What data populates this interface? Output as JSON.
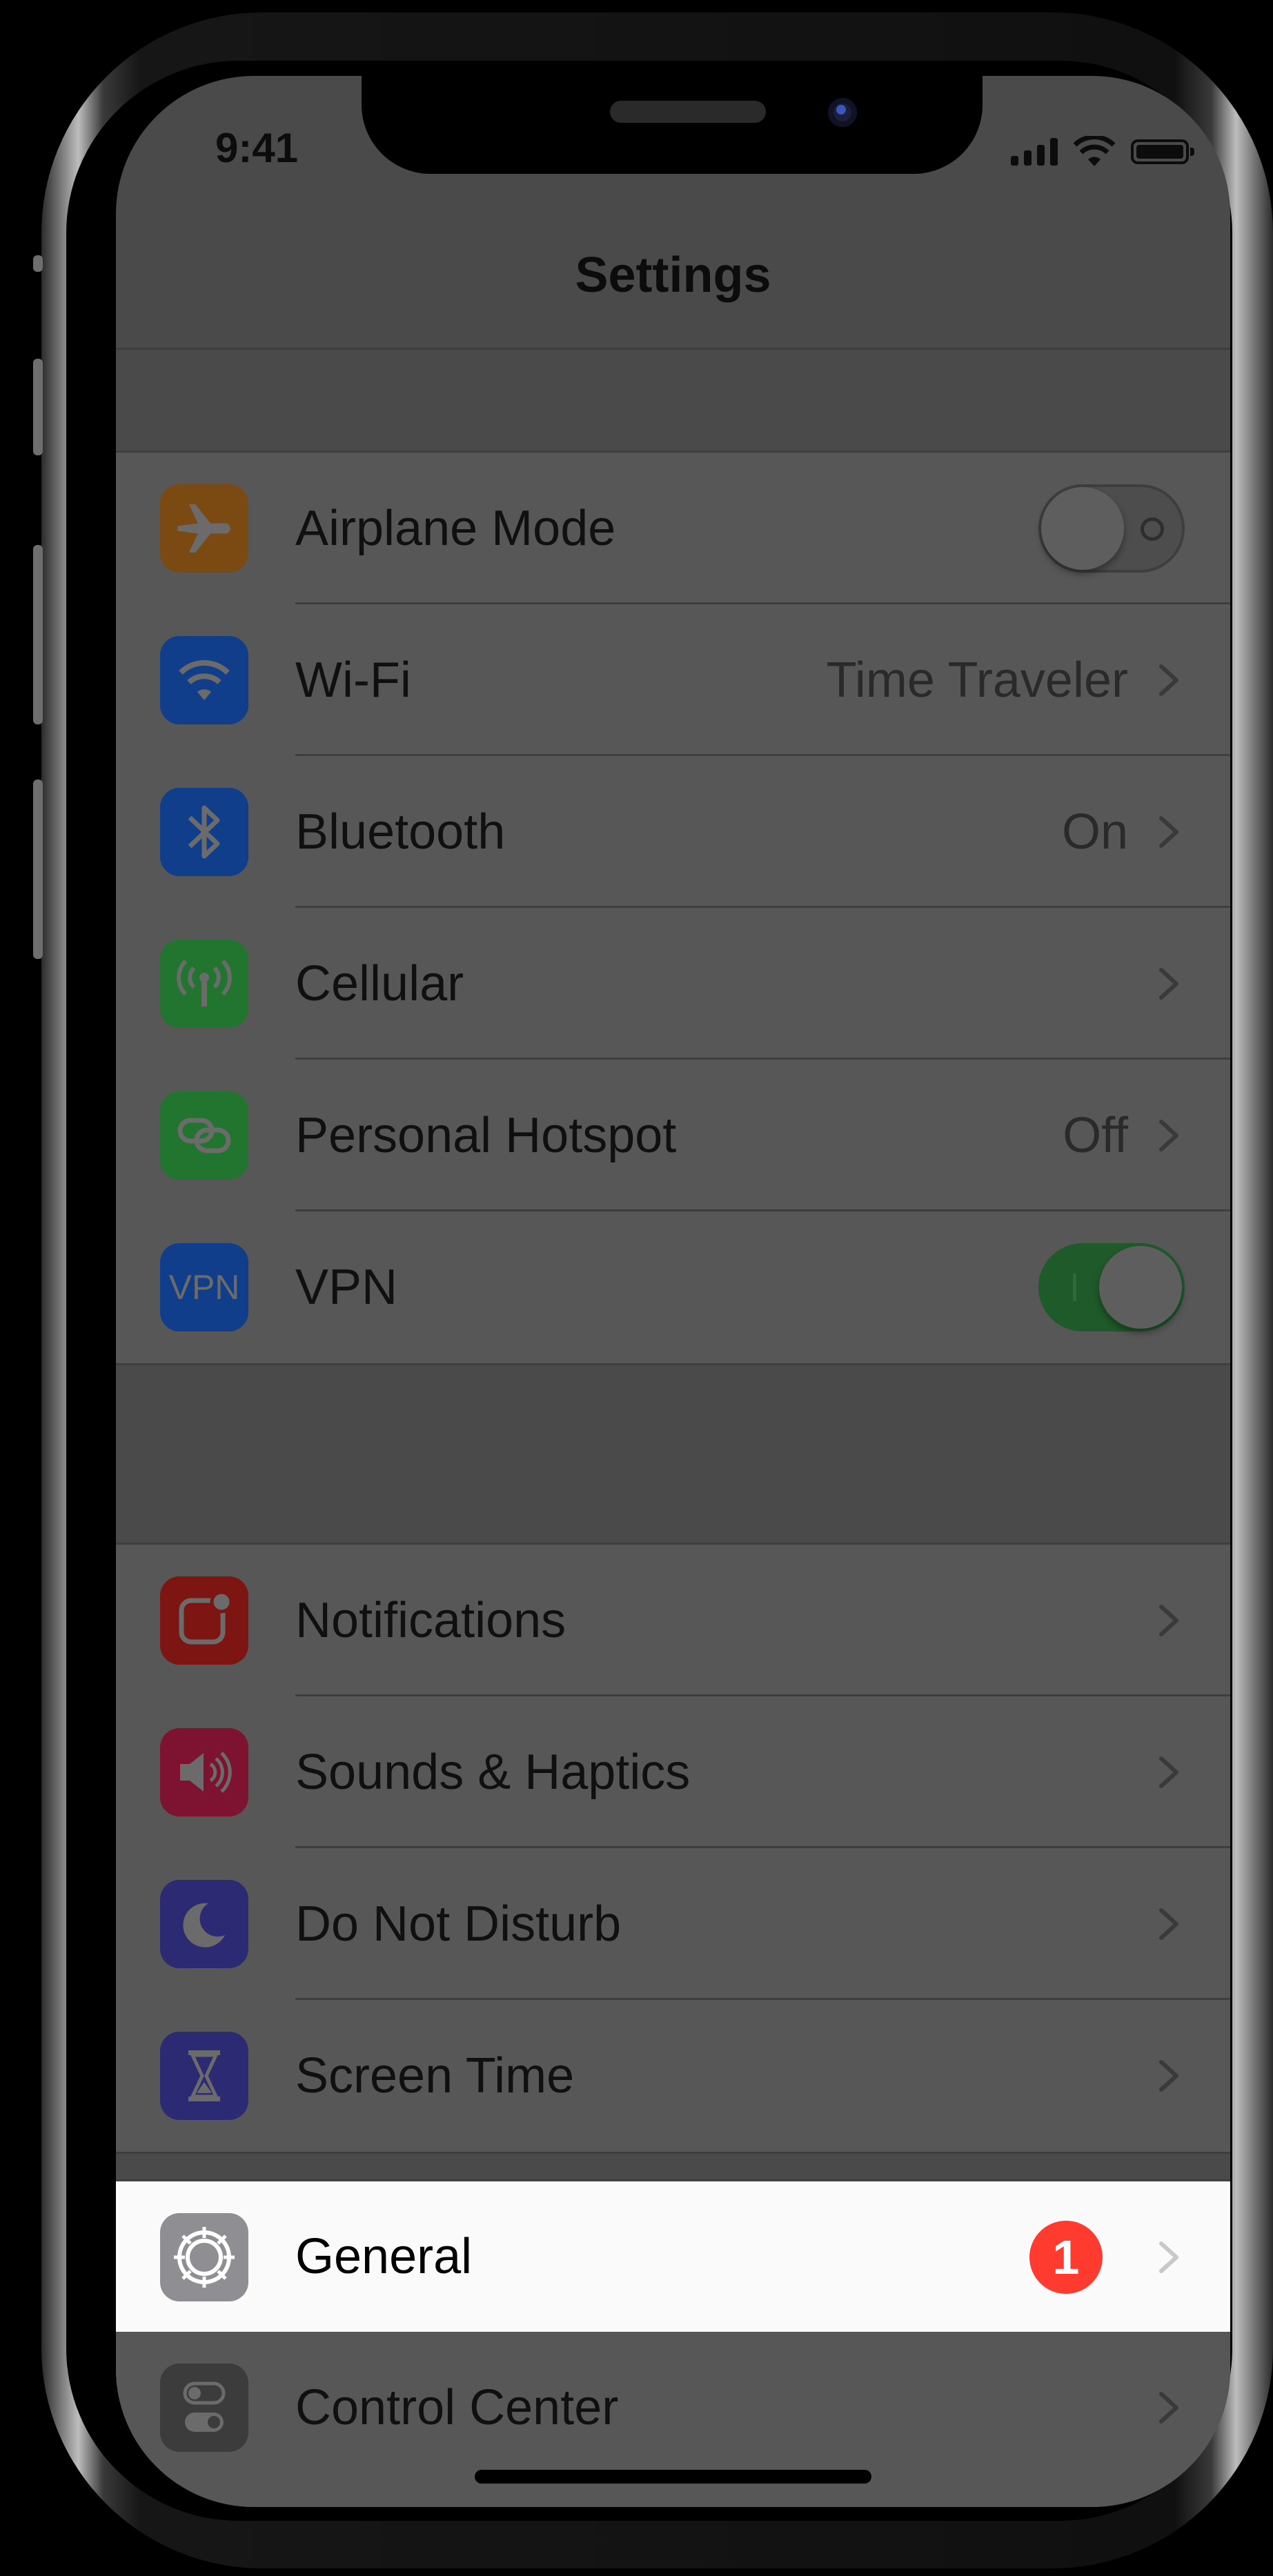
{
  "status_bar": {
    "time": "9:41"
  },
  "nav": {
    "title": "Settings"
  },
  "group1": [
    {
      "label": "Airplane Mode",
      "icon": "airplane-icon",
      "icon_color": "#7a4a12",
      "accessory": "toggle",
      "toggle_on": false
    },
    {
      "label": "Wi-Fi",
      "icon": "wifi-icon",
      "icon_color": "#103e8a",
      "value": "Time Traveler",
      "accessory": "chevron"
    },
    {
      "label": "Bluetooth",
      "icon": "bluetooth-icon",
      "icon_color": "#103e8a",
      "value": "On",
      "accessory": "chevron"
    },
    {
      "label": "Cellular",
      "icon": "cellular-antenna-icon",
      "icon_color": "#22752f",
      "accessory": "chevron"
    },
    {
      "label": "Personal Hotspot",
      "icon": "hotspot-link-icon",
      "icon_color": "#22752f",
      "value": "Off",
      "accessory": "chevron"
    },
    {
      "label": "VPN",
      "icon": "vpn-icon",
      "icon_color": "#103e8a",
      "icon_text": "VPN",
      "accessory": "toggle",
      "toggle_on": true
    }
  ],
  "group2": [
    {
      "label": "Notifications",
      "icon": "notifications-icon",
      "icon_color": "#7d1612",
      "accessory": "chevron"
    },
    {
      "label": "Sounds & Haptics",
      "icon": "speaker-icon",
      "icon_color": "#7d1330",
      "accessory": "chevron"
    },
    {
      "label": "Do Not Disturb",
      "icon": "moon-icon",
      "icon_color": "#2d2a74",
      "accessory": "chevron"
    },
    {
      "label": "Screen Time",
      "icon": "hourglass-icon",
      "icon_color": "#2d2a74",
      "accessory": "chevron"
    }
  ],
  "group3": [
    {
      "label": "General",
      "icon": "gear-icon",
      "icon_color": "#8e8e93",
      "badge": "1",
      "accessory": "chevron",
      "highlighted": true
    },
    {
      "label": "Control Center",
      "icon": "control-center-icon",
      "icon_color": "#3c3c3c",
      "accessory": "chevron"
    }
  ],
  "colors": {
    "screen_dim": "#4a4a4a",
    "cell_dim": "#575757",
    "badge": "#ff3b30",
    "highlight": "#fafafa"
  }
}
